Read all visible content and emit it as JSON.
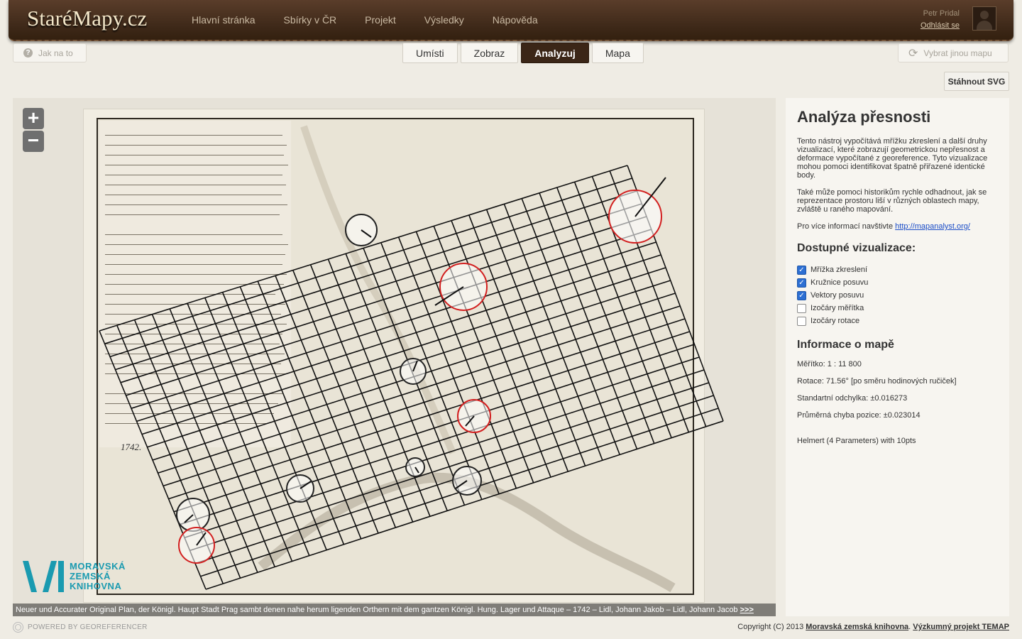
{
  "header": {
    "logo": "StaréMapy.cz",
    "nav": [
      "Hlavní stránka",
      "Sbírky v ČR",
      "Projekt",
      "Výsledky",
      "Nápověda"
    ],
    "user_name": "Petr Pridal",
    "logout": "Odhlásit se"
  },
  "toolbar": {
    "help": "Jak na to",
    "tabs": [
      "Umísti",
      "Zobraz",
      "Analyzuj",
      "Mapa"
    ],
    "active_tab": "Analyzuj",
    "other_map": "Vybrat jinou mapu",
    "download_svg": "Stáhnout SVG"
  },
  "map": {
    "zoom_in": "+",
    "zoom_out": "−",
    "year": "1742.",
    "logo_lines": [
      "MORAVSKÁ",
      "ZEMSKÁ",
      "KNIHOVNA"
    ],
    "caption": "Neuer und Accurater Original Plan, der Königl. Haupt Stadt Prag sambt denen nahe herum ligenden Orthern mit dem gantzen Königl. Hung. Lager und Attaque – 1742 – Lidl, Johann Jakob – Lidl, Johann Jacob",
    "caption_more": ">>>"
  },
  "panel": {
    "title": "Analýza přesnosti",
    "para1": "Tento nástroj vypočítává mřížku zkreslení a další druhy vizualizací, které zobrazují geometrickou nepřesnost a deformace vypočítané z georeference. Tyto vizualizace mohou pomoci identifikovat špatně přiřazené identické body.",
    "para2": "Také může pomoci historikům rychle odhadnout, jak se reprezentace prostoru liší v různých oblastech mapy, zvláště u raného mapování.",
    "para3_text": "Pro více informací navštivte",
    "para3_link": "http://mapanalyst.org/",
    "vis_heading": "Dostupné vizualizace:",
    "visualizations": [
      {
        "label": "Mřížka zkreslení",
        "checked": true
      },
      {
        "label": "Kružnice posuvu",
        "checked": true
      },
      {
        "label": "Vektory posuvu",
        "checked": true
      },
      {
        "label": "Izočáry měřítka",
        "checked": false
      },
      {
        "label": "Izočáry rotace",
        "checked": false
      }
    ],
    "info_heading": "Informace o mapě",
    "scale": "Měřítko: 1 : 11 800",
    "rotation": "Rotace: 71.56° [po směru hodinových ručiček]",
    "std_dev": "Standartní odchylka: ±0.016273",
    "mean_error": "Průměrná chyba pozice: ±0.023014",
    "transform": "Helmert (4 Parameters) with 10pts"
  },
  "footer": {
    "powered": "POWERED BY GEOREFERENCER",
    "copyright": "Copyright (C) 2013",
    "link1": "Moravská zemská knihovna",
    "link2": "Výzkumný projekt TEMAP"
  }
}
